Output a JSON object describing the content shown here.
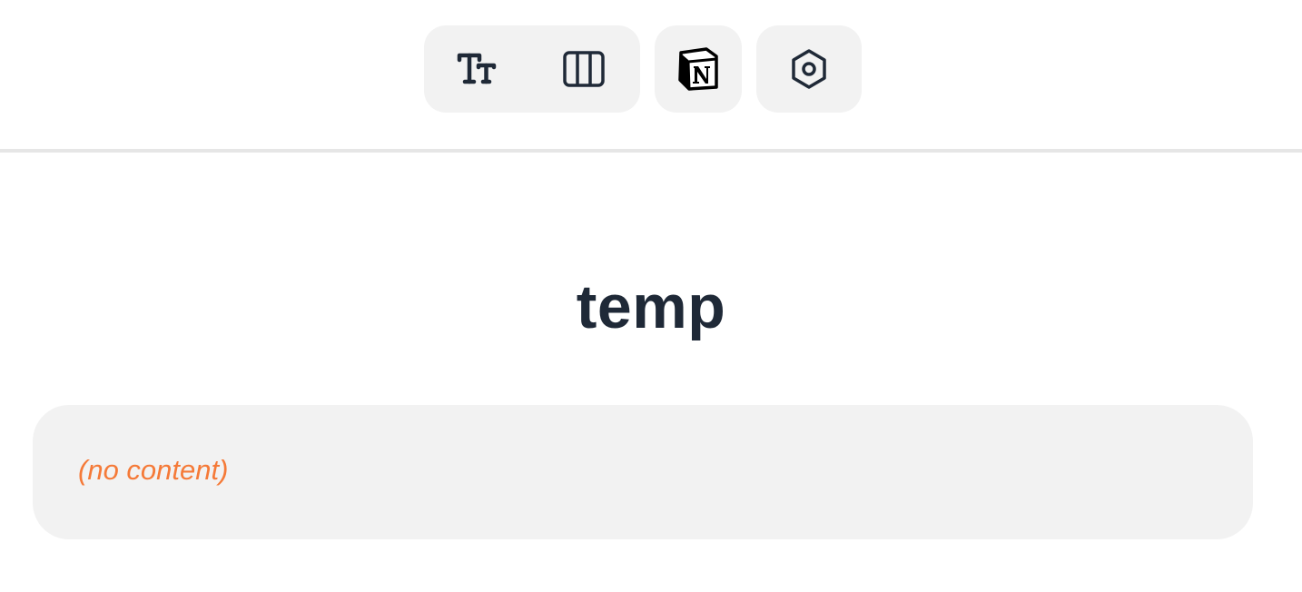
{
  "toolbar": {
    "groups": [
      {
        "name": "format-group",
        "buttons": [
          {
            "icon": "text-size-icon"
          },
          {
            "icon": "columns-icon"
          }
        ]
      },
      {
        "name": "notion-group",
        "buttons": [
          {
            "icon": "notion-logo-icon"
          }
        ]
      },
      {
        "name": "settings-group",
        "buttons": [
          {
            "icon": "hexagon-settings-icon"
          }
        ]
      }
    ]
  },
  "page": {
    "title": "temp"
  },
  "content": {
    "empty_text": "(no content)"
  },
  "colors": {
    "text": "#1f2937",
    "button_bg": "#f2f2f2",
    "divider": "#e6e6e6",
    "empty_text": "#f57a38"
  }
}
